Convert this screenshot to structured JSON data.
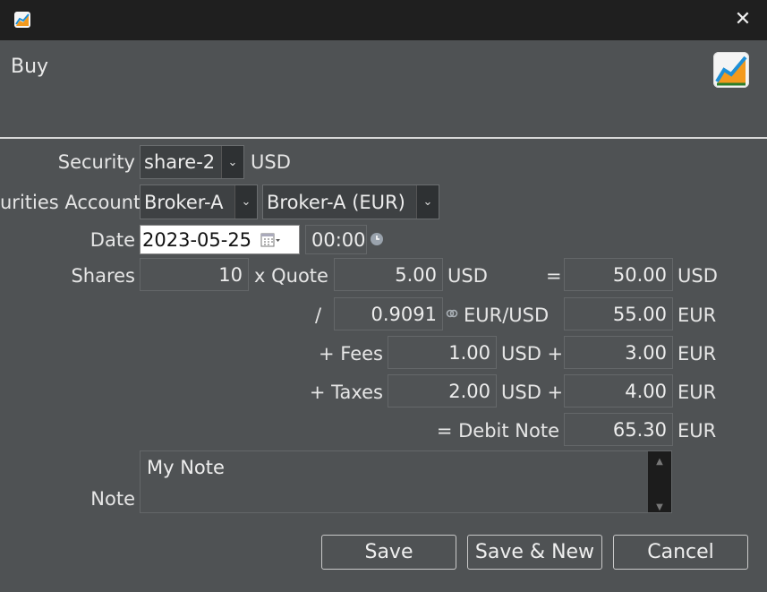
{
  "window": {
    "close_symbol": "✕"
  },
  "header": {
    "title": "Buy"
  },
  "security": {
    "label": "Security",
    "value": "share-2",
    "currency": "USD"
  },
  "account": {
    "label": "urities Account",
    "value": "Broker-A",
    "cash_value": "Broker-A (EUR)"
  },
  "date": {
    "label": "Date",
    "value": "2023-05-25",
    "time": "00:00"
  },
  "shares": {
    "label": "Shares",
    "value": "10",
    "x_quote_label": "x Quote",
    "quote": "5.00",
    "quote_currency": "USD",
    "equals": "=",
    "gross": "50.00",
    "gross_currency": "USD"
  },
  "exchange": {
    "div": "/",
    "rate": "0.9091",
    "pair": "EUR/USD",
    "converted": "55.00",
    "converted_currency": "EUR"
  },
  "fees": {
    "label": "+ Fees",
    "value": "1.00",
    "currency_plus": "USD +",
    "converted": "3.00",
    "converted_currency": "EUR"
  },
  "taxes": {
    "label": "+ Taxes",
    "value": "2.00",
    "currency_plus": "USD +",
    "converted": "4.00",
    "converted_currency": "EUR"
  },
  "debit": {
    "label": "= Debit Note",
    "value": "65.30",
    "currency": "EUR"
  },
  "note": {
    "label": "Note",
    "value": "My Note"
  },
  "buttons": {
    "save": "Save",
    "save_new": "Save & New",
    "cancel": "Cancel"
  },
  "colors": {
    "titlebar": "#1f1f1f",
    "body": "#4f5254",
    "accent_orange": "#f39a1e",
    "accent_blue": "#1e8fd6"
  }
}
